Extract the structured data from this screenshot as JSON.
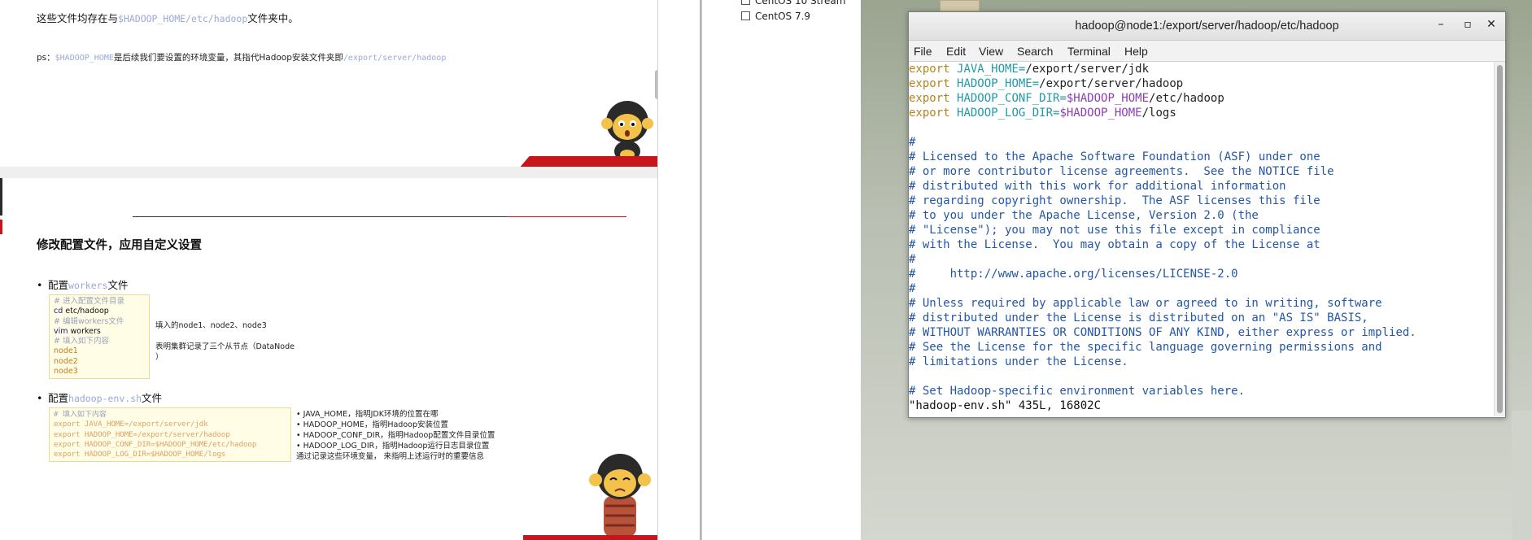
{
  "doc": {
    "slide1": {
      "line1_pre": "这些文件均存在与",
      "line1_code": "$HADOOP_HOME/etc/hadoop",
      "line1_post": "文件夹中。",
      "ps_prefix": "ps：",
      "ps_code1": "$HADOOP_HOME",
      "ps_mid": "是后续我们要设置的环境变量，其指代Hadoop安装文件夹即",
      "ps_code2": "/export/server/hadoop"
    },
    "slide2": {
      "heading": "修改配置文件，应用自定义设置",
      "bullet1_pre": "配置",
      "bullet1_code": "workers",
      "bullet1_post": "文件",
      "workers_code": [
        {
          "cls": "c-comment",
          "text": "# 进入配置文件目录"
        },
        {
          "cls": "c-kw",
          "text": "cd",
          "rest": " etc/hadoop"
        },
        {
          "cls": "c-comment",
          "text": "# 编辑workers文件"
        },
        {
          "cls": "c-kw",
          "text": "vim",
          "rest": " workers"
        },
        {
          "cls": "c-comment",
          "text": "# 填入如下内容"
        },
        {
          "cls": "c-num",
          "text": "node1"
        },
        {
          "cls": "c-num",
          "text": "node2"
        },
        {
          "cls": "c-num",
          "text": "node3"
        }
      ],
      "workers_note1": "填入的node1、node2、node3",
      "workers_note2": "表明集群记录了三个从节点（DataNode",
      "workers_note3": "）",
      "bullet2_pre": "配置",
      "bullet2_code": "hadoop-env.sh",
      "bullet2_post": "文件",
      "env_code": [
        {
          "text": "# 填入如下内容"
        },
        {
          "text": "export JAVA_HOME=/export/server/jdk"
        },
        {
          "text": "export HADOOP_HOME=/export/server/hadoop"
        },
        {
          "text": "export HADOOP_CONF_DIR=$HADOOP_HOME/etc/hadoop"
        },
        {
          "text": "export HADOOP_LOG_DIR=$HADOOP_HOME/logs"
        }
      ],
      "env_notes": [
        "•  JAVA_HOME，指明JDK环境的位置在哪",
        "•  HADOOP_HOME，指明Hadoop安装位置",
        "•  HADOOP_CONF_DIR，指明Hadoop配置文件目录位置",
        "•  HADOOP_LOG_DIR，指明Hadoop运行日志目录位置",
        "通过记录这些环境变量， 来指明上述运行时的重要信息"
      ]
    }
  },
  "mid": {
    "item1": "CentOS 10 Stream",
    "item2": "CentOS 7.9"
  },
  "terminal": {
    "title": "hadoop@node1:/export/server/hadoop/etc/hadoop",
    "minimize": "–",
    "maximize": "▫",
    "close": "✕",
    "menu": [
      "File",
      "Edit",
      "View",
      "Search",
      "Terminal",
      "Help"
    ],
    "exports": [
      {
        "kw": "export",
        "var": "JAVA_HOME=",
        "dollar": "",
        "val": "/export/server/jdk"
      },
      {
        "kw": "export",
        "var": "HADOOP_HOME=",
        "dollar": "",
        "val": "/export/server/hadoop"
      },
      {
        "kw": "export",
        "var": "HADOOP_CONF_DIR=",
        "dollar": "$HADOOP_HOME",
        "val": "/etc/hadoop"
      },
      {
        "kw": "export",
        "var": "HADOOP_LOG_DIR=",
        "dollar": "$HADOOP_HOME",
        "val": "/logs"
      }
    ],
    "comments": [
      "",
      "#",
      "# Licensed to the Apache Software Foundation (ASF) under one",
      "# or more contributor license agreements.  See the NOTICE file",
      "# distributed with this work for additional information",
      "# regarding copyright ownership.  The ASF licenses this file",
      "# to you under the Apache License, Version 2.0 (the",
      "# \"License\"); you may not use this file except in compliance",
      "# with the License.  You may obtain a copy of the License at",
      "#",
      "#     http://www.apache.org/licenses/LICENSE-2.0",
      "#",
      "# Unless required by applicable law or agreed to in writing, software",
      "# distributed under the License is distributed on an \"AS IS\" BASIS,",
      "# WITHOUT WARRANTIES OR CONDITIONS OF ANY KIND, either express or implied.",
      "# See the License for the specific language governing permissions and",
      "# limitations under the License.",
      "",
      "# Set Hadoop-specific environment variables here."
    ],
    "status": "\"hadoop-env.sh\" 435L, 16802C"
  }
}
